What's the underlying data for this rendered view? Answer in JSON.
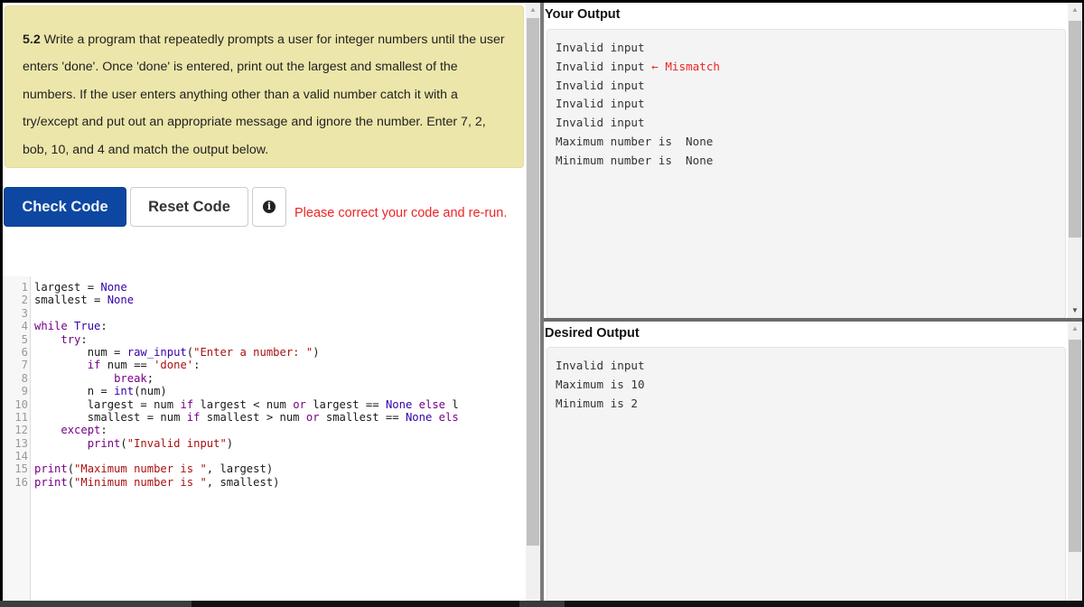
{
  "problem": {
    "number": "5.2",
    "text": " Write a program that repeatedly prompts a user for integer numbers until the user enters 'done'. Once 'done' is entered, print out the largest and smallest of the numbers. If the user enters anything other than a valid number catch it with a try/except and put out an appropriate message and ignore the number. Enter 7, 2, bob, 10, and 4 and match the output below."
  },
  "buttons": {
    "check_code": "Check Code",
    "reset_code": "Reset Code",
    "info_icon": "info-circle-icon"
  },
  "feedback": "Please correct your code and re-run.",
  "colors": {
    "primary": "#0d47a1",
    "error": "#f02424",
    "prompt_bg": "#ede6aa"
  },
  "editor": {
    "lines": [
      {
        "n": "1",
        "tokens": [
          {
            "t": "largest = ",
            "c": ""
          },
          {
            "t": "None",
            "c": "bi"
          }
        ]
      },
      {
        "n": "2",
        "tokens": [
          {
            "t": "smallest = ",
            "c": ""
          },
          {
            "t": "None",
            "c": "bi"
          }
        ]
      },
      {
        "n": "3",
        "tokens": []
      },
      {
        "n": "4",
        "tokens": [
          {
            "t": "while",
            "c": "kw"
          },
          {
            "t": " ",
            "c": ""
          },
          {
            "t": "True",
            "c": "bi"
          },
          {
            "t": ":",
            "c": ""
          }
        ]
      },
      {
        "n": "5",
        "tokens": [
          {
            "t": "    ",
            "c": ""
          },
          {
            "t": "try",
            "c": "kw"
          },
          {
            "t": ":",
            "c": ""
          }
        ]
      },
      {
        "n": "6",
        "tokens": [
          {
            "t": "        num = ",
            "c": ""
          },
          {
            "t": "raw_input",
            "c": "bi"
          },
          {
            "t": "(",
            "c": ""
          },
          {
            "t": "\"Enter a number: \"",
            "c": "str"
          },
          {
            "t": ")",
            "c": ""
          }
        ]
      },
      {
        "n": "7",
        "tokens": [
          {
            "t": "        ",
            "c": ""
          },
          {
            "t": "if",
            "c": "kw"
          },
          {
            "t": " num == ",
            "c": ""
          },
          {
            "t": "'done'",
            "c": "str"
          },
          {
            "t": ":",
            "c": ""
          }
        ]
      },
      {
        "n": "8",
        "tokens": [
          {
            "t": "            ",
            "c": ""
          },
          {
            "t": "break",
            "c": "kw"
          },
          {
            "t": ";",
            "c": ""
          }
        ]
      },
      {
        "n": "9",
        "tokens": [
          {
            "t": "        n = ",
            "c": ""
          },
          {
            "t": "int",
            "c": "bi"
          },
          {
            "t": "(num)",
            "c": ""
          }
        ]
      },
      {
        "n": "10",
        "tokens": [
          {
            "t": "        largest = num ",
            "c": ""
          },
          {
            "t": "if",
            "c": "kw"
          },
          {
            "t": " largest < num ",
            "c": ""
          },
          {
            "t": "or",
            "c": "kw"
          },
          {
            "t": " largest == ",
            "c": ""
          },
          {
            "t": "None",
            "c": "bi"
          },
          {
            "t": " ",
            "c": ""
          },
          {
            "t": "else",
            "c": "kw"
          },
          {
            "t": " l",
            "c": ""
          }
        ]
      },
      {
        "n": "11",
        "tokens": [
          {
            "t": "        smallest = num ",
            "c": ""
          },
          {
            "t": "if",
            "c": "kw"
          },
          {
            "t": " smallest > num ",
            "c": ""
          },
          {
            "t": "or",
            "c": "kw"
          },
          {
            "t": " smallest == ",
            "c": ""
          },
          {
            "t": "None",
            "c": "bi"
          },
          {
            "t": " ",
            "c": ""
          },
          {
            "t": "els",
            "c": "kw"
          }
        ]
      },
      {
        "n": "12",
        "tokens": [
          {
            "t": "    ",
            "c": ""
          },
          {
            "t": "except",
            "c": "kw"
          },
          {
            "t": ":",
            "c": ""
          }
        ]
      },
      {
        "n": "13",
        "tokens": [
          {
            "t": "        ",
            "c": ""
          },
          {
            "t": "print",
            "c": "kw"
          },
          {
            "t": "(",
            "c": ""
          },
          {
            "t": "\"Invalid input\"",
            "c": "str"
          },
          {
            "t": ")",
            "c": ""
          }
        ]
      },
      {
        "n": "14",
        "tokens": []
      },
      {
        "n": "15",
        "tokens": [
          {
            "t": "print",
            "c": "kw"
          },
          {
            "t": "(",
            "c": ""
          },
          {
            "t": "\"Maximum number is \"",
            "c": "str"
          },
          {
            "t": ", largest)",
            "c": ""
          }
        ]
      },
      {
        "n": "16",
        "tokens": [
          {
            "t": "print",
            "c": "kw"
          },
          {
            "t": "(",
            "c": ""
          },
          {
            "t": "\"Minimum number is \"",
            "c": "str"
          },
          {
            "t": ", smallest)",
            "c": ""
          }
        ]
      }
    ]
  },
  "your_output": {
    "title": "Your Output",
    "lines": [
      {
        "text": "Invalid input",
        "note": ""
      },
      {
        "text": "Invalid input",
        "note": " ← Mismatch"
      },
      {
        "text": "Invalid input",
        "note": ""
      },
      {
        "text": "Invalid input",
        "note": ""
      },
      {
        "text": "Invalid input",
        "note": ""
      },
      {
        "text": "Maximum number is  None",
        "note": ""
      },
      {
        "text": "Minimum number is  None",
        "note": ""
      }
    ]
  },
  "desired_output": {
    "title": "Desired Output",
    "lines": [
      {
        "text": "Invalid input"
      },
      {
        "text": "Maximum is 10"
      },
      {
        "text": "Minimum is 2"
      }
    ]
  }
}
